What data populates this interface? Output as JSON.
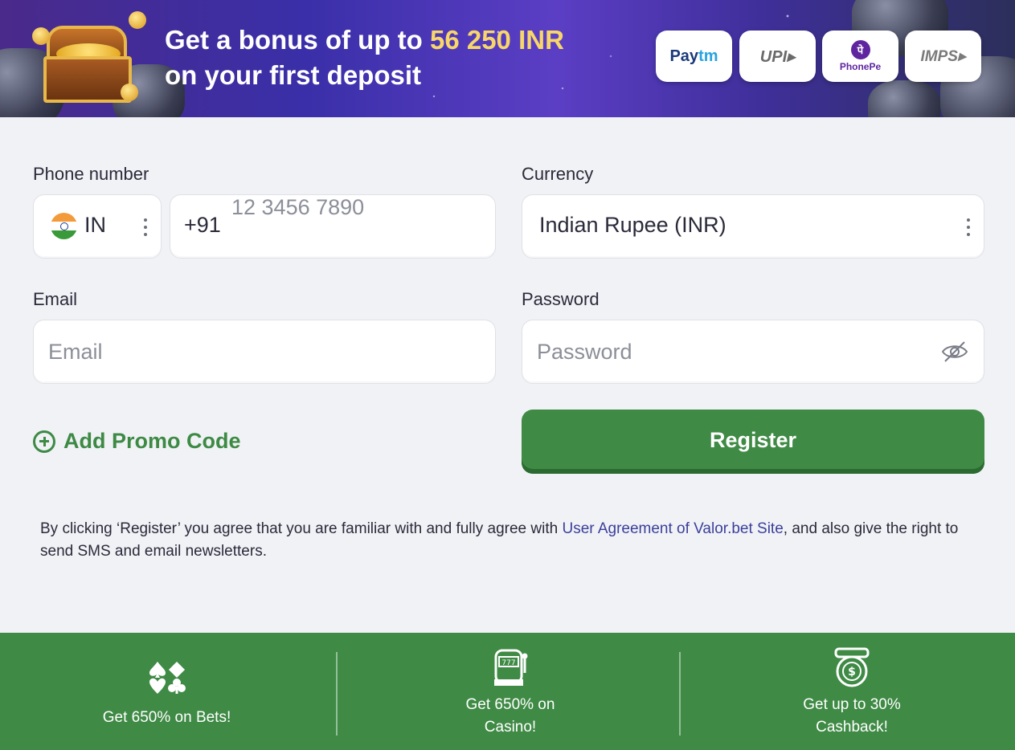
{
  "banner": {
    "title_line1_prefix": "Get a bonus of up to ",
    "title_amount": "56 250 INR",
    "title_line2": "on your first deposit",
    "payments": [
      {
        "name": "Paytm",
        "label_a": "Pay",
        "label_b": "tm"
      },
      {
        "name": "UPI",
        "label": "UPI▸"
      },
      {
        "name": "PhonePe",
        "label": "PhonePe",
        "logo": "पे"
      },
      {
        "name": "IMPS",
        "label": "IMPS▸"
      }
    ]
  },
  "form": {
    "phone_label": "Phone number",
    "country_code": "IN",
    "dial_code": "+91",
    "phone_placeholder": "12 3456 7890",
    "currency_label": "Currency",
    "currency_value": "Indian Rupee (INR)",
    "email_label": "Email",
    "email_placeholder": "Email",
    "password_label": "Password",
    "password_placeholder": "Password",
    "promo_label": "Add Promo Code",
    "register_label": "Register"
  },
  "terms": {
    "before": "By clicking ‘Register’ you agree that you are familiar with and fully agree with ",
    "link": "User Agreement of Valor.bet Site",
    "after": ", and also give the right to send SMS and email newsletters."
  },
  "footer": {
    "items": [
      {
        "label": "Get 650% on Bets!",
        "icon": "card-suits-icon"
      },
      {
        "label": "Get 650% on Casino!",
        "icon": "slot-machine-icon"
      },
      {
        "label": "Get up to 30% Cashback!",
        "icon": "cashback-chip-icon"
      }
    ]
  },
  "colors": {
    "accent_green": "#3f8a45",
    "link_blue": "#3b3f9a",
    "highlight_yellow": "#f7d66a",
    "page_bg": "#f1f2f6"
  }
}
